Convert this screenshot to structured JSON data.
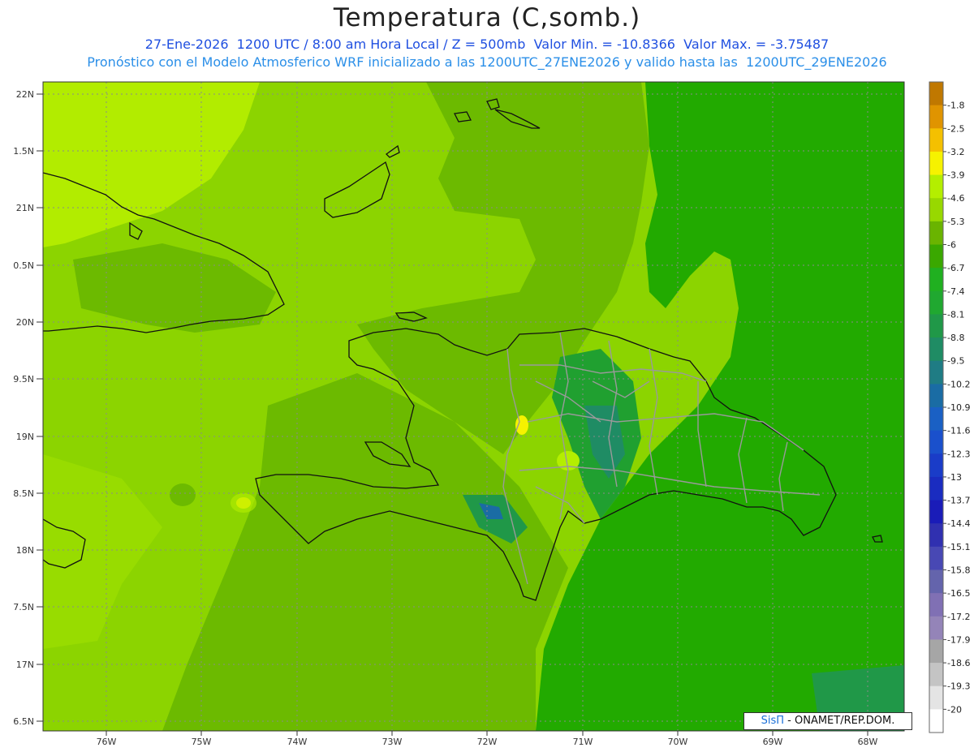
{
  "header": {
    "title": "Temperatura (C,somb.)",
    "line1": "27-Ene-2026  1200 UTC / 8:00 am Hora Local / Z = 500mb  Valor Min. = -10.8366  Valor Max. = -3.75487",
    "line2": "Pronóstico con el Modelo Atmosferico WRF inicializado a las 1200UTC_27ENE2026 y valido hasta las  1200UTC_29ENE2026"
  },
  "map": {
    "lat_labels": [
      "22N",
      "1.5N",
      "21N",
      "0.5N",
      "20N",
      "9.5N",
      "19N",
      "8.5N",
      "18N",
      "7.5N",
      "17N",
      "6.5N"
    ],
    "lon_labels": [
      "76W",
      "75W",
      "74W",
      "73W",
      "72W",
      "71W",
      "70W",
      "69W",
      "68W"
    ]
  },
  "legend": {
    "labels": [
      "-1.8",
      "-2.5",
      "-3.2",
      "-3.9",
      "-4.6",
      "-5.3",
      "-6",
      "-6.7",
      "-7.4",
      "-8.1",
      "-8.8",
      "-9.5",
      "-10.2",
      "-10.9",
      "-11.6",
      "-12.3",
      "-13",
      "-13.7",
      "-14.4",
      "-15.1",
      "-15.8",
      "-16.5",
      "-17.2",
      "-17.9",
      "-18.6",
      "-19.3",
      "-20"
    ],
    "colors": [
      "#c07800",
      "#e09400",
      "#f4c000",
      "#f6f200",
      "#b4ee00",
      "#98d800",
      "#6ab400",
      "#3aa800",
      "#20b020",
      "#20a830",
      "#209848",
      "#1f8c64",
      "#1f7c84",
      "#1a6ca4",
      "#1a60c4",
      "#1a50cc",
      "#1a3cc8",
      "#1a2cc0",
      "#1a1cb8",
      "#3030b0",
      "#4848b4",
      "#6464ac",
      "#8070b4",
      "#9484b8",
      "#a6a6a6",
      "#c4c4c4",
      "#e4e4e4",
      "#ffffff"
    ]
  },
  "credit": {
    "logo": "SisΠ",
    "text": " - ONAMET/REP.DOM."
  }
}
